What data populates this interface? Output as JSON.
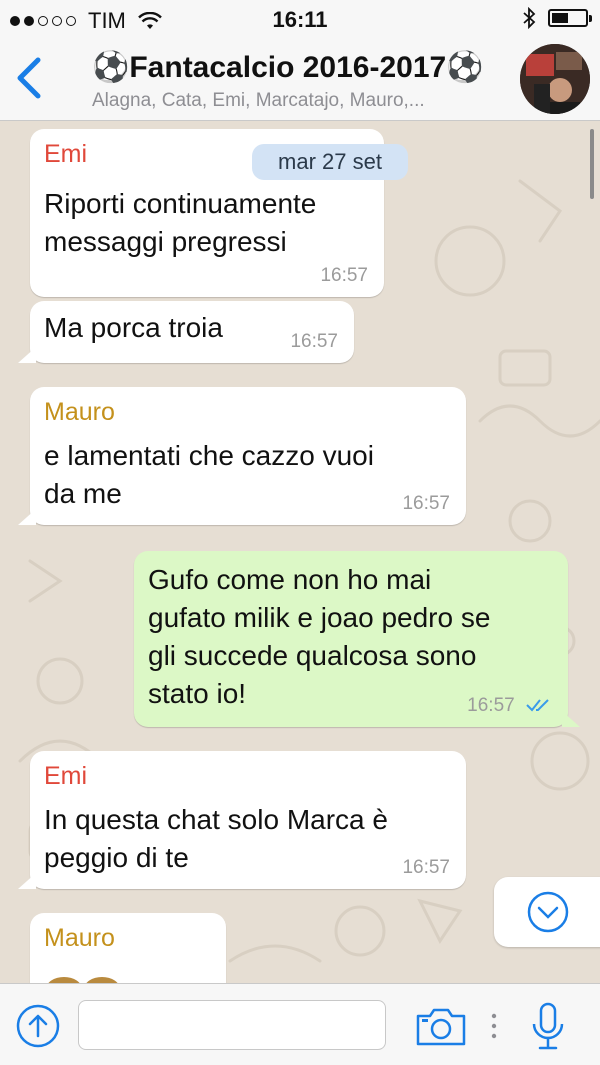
{
  "status_bar": {
    "carrier": "TIM",
    "time": "16:11"
  },
  "header": {
    "title": "⚽Fantacalcio 2016-2017⚽",
    "subtitle": "Alagna, Cata, Emi, Marcatajo, Mauro,..."
  },
  "chat": {
    "date_pill": "mar 27 set",
    "messages": [
      {
        "sender": "Emi",
        "lines": [
          "Riporti continuamente",
          "messaggi pregressi"
        ],
        "time": "16:57"
      },
      {
        "sender": "",
        "lines": [
          "Ma porca troia"
        ],
        "time": "16:57"
      },
      {
        "sender": "Mauro",
        "lines": [
          "e lamentati che cazzo vuoi",
          "da me"
        ],
        "time": "16:57"
      },
      {
        "sender": "",
        "lines": [
          "Gufo come non ho mai",
          "gufato milik e joao pedro se",
          "gli succede qualcosa sono",
          "stato io!"
        ],
        "time": "16:57"
      },
      {
        "sender": "Emi",
        "lines": [
          "In questa chat solo Marca è",
          "peggio di te"
        ],
        "time": "16:57"
      },
      {
        "sender": "Mauro",
        "lines": [],
        "time": ""
      }
    ]
  },
  "colors": {
    "emi": "#e0483a",
    "mauro": "#c4911c",
    "ios_blue": "#1a7ee6",
    "outgoing": "#dcf8c6",
    "date_pill": "#d3e3f5"
  },
  "icons": {
    "back": "chevron-left-icon",
    "share": "arrow-up-circle-icon",
    "camera": "camera-icon",
    "mic": "microphone-icon",
    "scroll": "chevron-down-circle-icon",
    "read": "double-check-icon"
  }
}
